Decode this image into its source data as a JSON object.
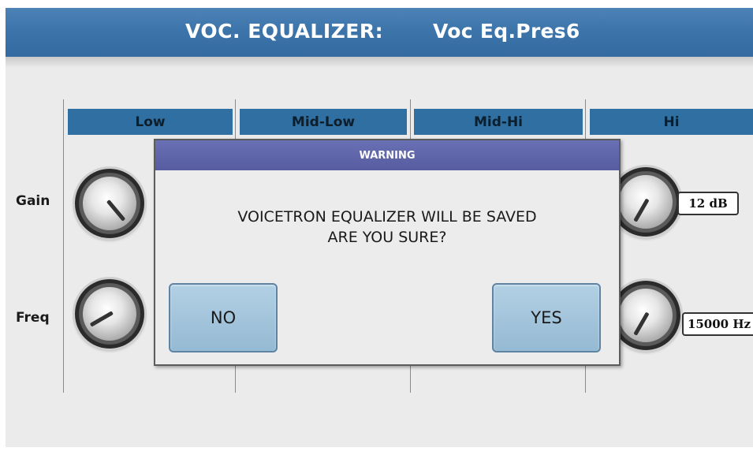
{
  "header": {
    "title": "VOC. EQUALIZER:",
    "preset": "Voc Eq.Pres6"
  },
  "bands": [
    "Low",
    "Mid-Low",
    "Mid-Hi",
    "Hi"
  ],
  "rows": {
    "gain_label": "Gain",
    "freq_label": "Freq"
  },
  "hi_band": {
    "gain_value": "12 dB",
    "freq_value": "15000 Hz"
  },
  "dialog": {
    "title": "WARNING",
    "line1": "VOICETRON EQUALIZER WILL BE SAVED",
    "line2": "ARE YOU SURE?",
    "no_label": "NO",
    "yes_label": "YES"
  },
  "colors": {
    "header": "#3d75ab",
    "band_header": "#2f6fa1",
    "dialog_title": "#5c62a6",
    "button": "#a3c6dc"
  },
  "icons": {
    "knob": "rotary-knob-icon"
  }
}
